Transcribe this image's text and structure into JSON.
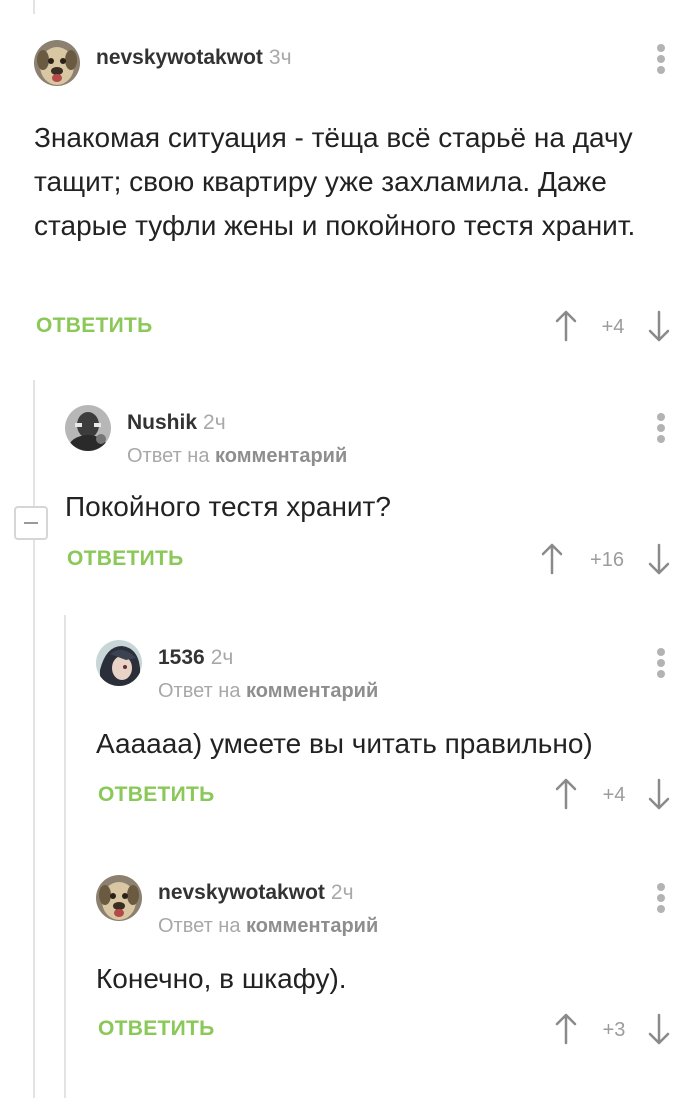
{
  "comments": [
    {
      "author": "nevskywotakwot",
      "time": "3ч",
      "reply_prefix": "",
      "reply_link": "",
      "text": "Знакомая ситуация - тёща всё старьё на дачу тащит; свою квартиру уже захламила. Даже старые туфли жены и покойного тестя хранит.",
      "reply_label": "ОТВЕТИТЬ",
      "score": "+4"
    },
    {
      "author": "Nushik",
      "time": "2ч",
      "reply_prefix": "Ответ на",
      "reply_link": "комментарий",
      "text": "Покойного тестя хранит?",
      "reply_label": "ОТВЕТИТЬ",
      "score": "+16"
    },
    {
      "author": "1536",
      "time": "2ч",
      "reply_prefix": "Ответ на",
      "reply_link": "комментарий",
      "text": "Аааааа) умеете вы читать правильно)",
      "reply_label": "ОТВЕТИТЬ",
      "score": "+4"
    },
    {
      "author": "nevskywotakwot",
      "time": "2ч",
      "reply_prefix": "Ответ на",
      "reply_link": "комментарий",
      "text": "Конечно, в шкафу).",
      "reply_label": "ОТВЕТИТЬ",
      "score": "+3"
    }
  ],
  "icons": {
    "avatar_1": "dog-avatar",
    "avatar_2": "dark-portrait-avatar",
    "avatar_3": "anime-avatar",
    "avatar_4": "dog-avatar",
    "more": "more-vertical-icon",
    "up": "arrow-up-icon",
    "down": "arrow-down-icon",
    "collapse": "collapse-minus-icon"
  },
  "colors": {
    "reply_green": "#8ac858",
    "muted_gray": "#a8a8a8",
    "thread_line": "#e3e3e3"
  }
}
